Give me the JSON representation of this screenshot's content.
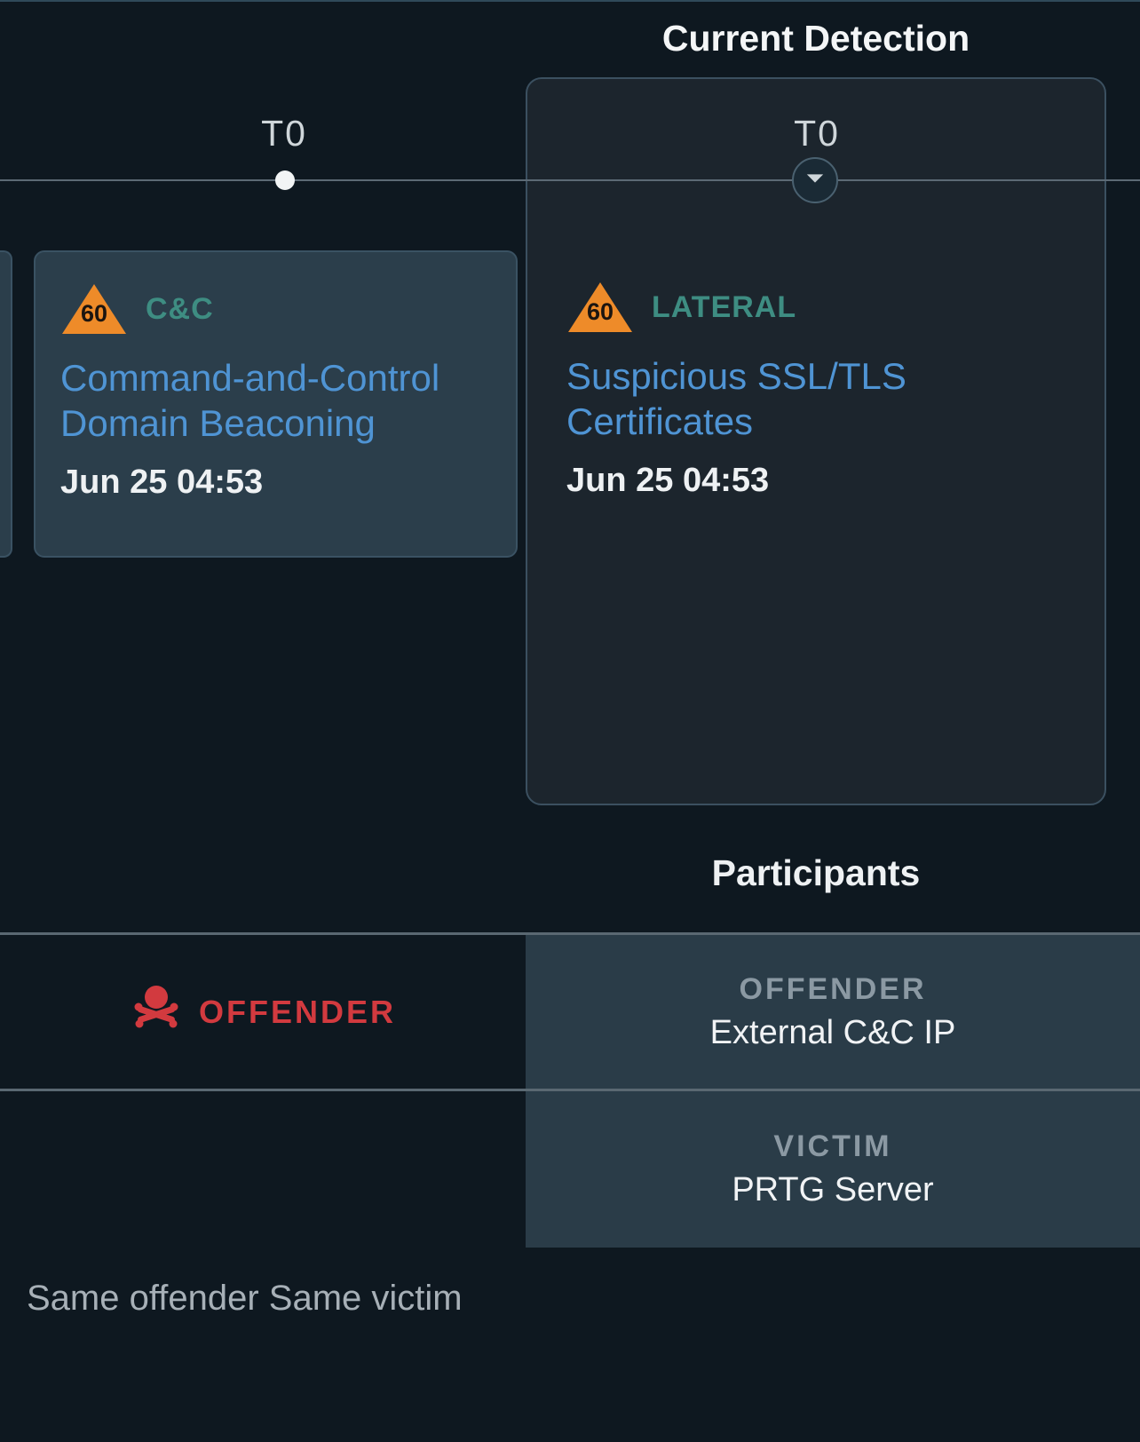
{
  "header": {
    "current_detection_title": "Current Detection",
    "t0_left": "T0",
    "t0_right": "T0"
  },
  "cards": [
    {
      "risk": "60",
      "category": "C&C",
      "title": "Command-and-Control Domain Beaconing",
      "time": "Jun 25 04:53"
    },
    {
      "risk": "60",
      "category": "LATERAL",
      "title": "Suspicious SSL/TLS Certificates",
      "time": "Jun 25 04:53"
    }
  ],
  "participants": {
    "header": "Participants",
    "left_role_label": "OFFENDER",
    "rows": [
      {
        "role": "OFFENDER",
        "value": "External C&C IP"
      },
      {
        "role": "VICTIM",
        "value": "PRTG Server"
      }
    ]
  },
  "footer_note": "Same offender Same victim",
  "colors": {
    "risk_triangle": "#ee8b29",
    "category_text": "#3e8d82",
    "card_title": "#4f94d4",
    "offender_red": "#d23a3f"
  }
}
